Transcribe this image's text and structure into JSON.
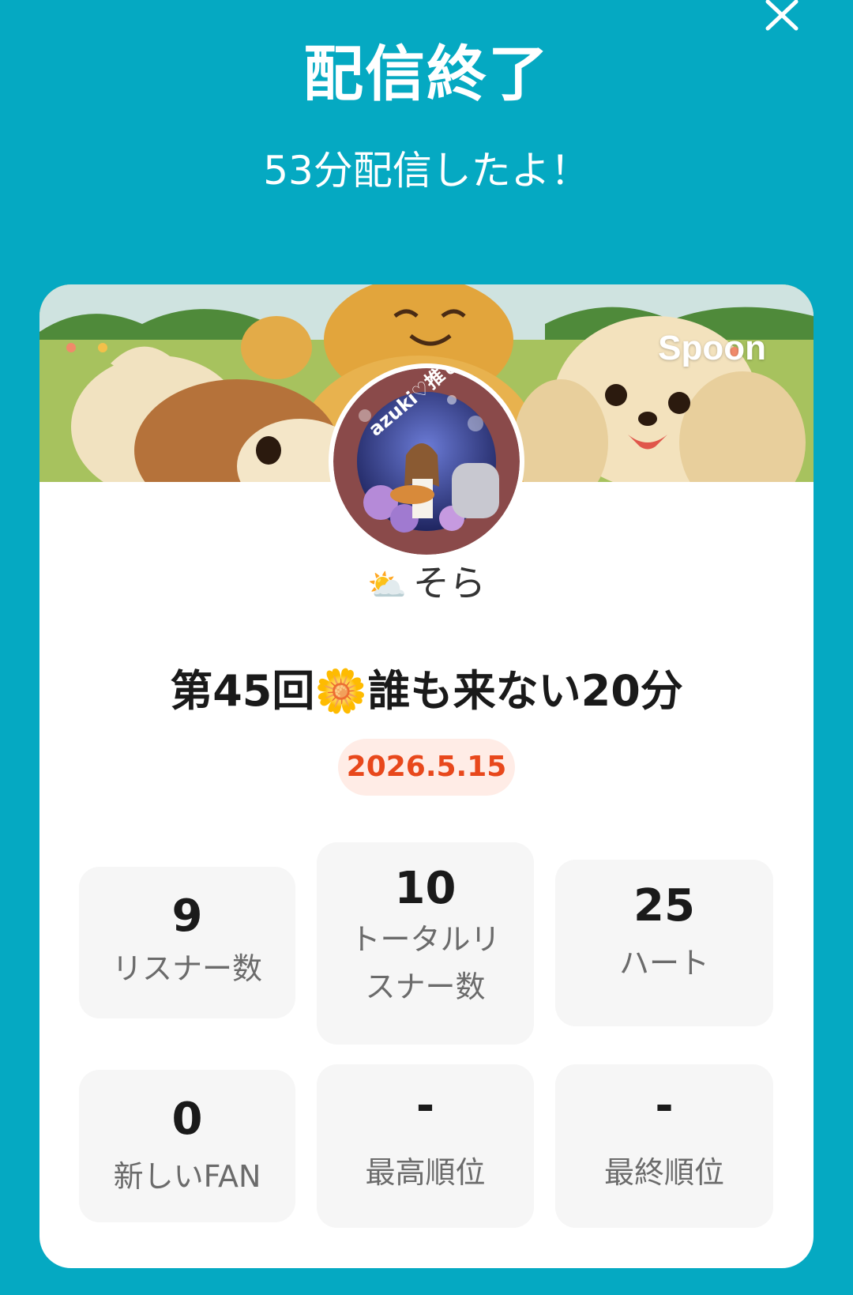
{
  "header": {
    "title": "配信終了",
    "subtitle": "53分配信したよ！",
    "close_icon": "close-icon"
  },
  "card": {
    "brand": "Spoon",
    "avatar_badge": "azuki♡推し",
    "user": {
      "emoji": "⛅",
      "name": "そら"
    },
    "stream_title": "第45回🌼誰も来ない20分",
    "date": "2026.5.15",
    "stats": [
      {
        "value": "9",
        "label": "リスナー数"
      },
      {
        "value": "10",
        "label": "トータルリスナー数"
      },
      {
        "value": "25",
        "label": "ハート"
      },
      {
        "value": "0",
        "label": "新しいFAN"
      },
      {
        "value": "-",
        "label": "最高順位"
      },
      {
        "value": "-",
        "label": "最終順位"
      }
    ]
  },
  "colors": {
    "background": "#05a9c2",
    "date_text": "#e8481c",
    "date_bg": "#ffece6",
    "stat_bg": "#f6f6f6"
  }
}
